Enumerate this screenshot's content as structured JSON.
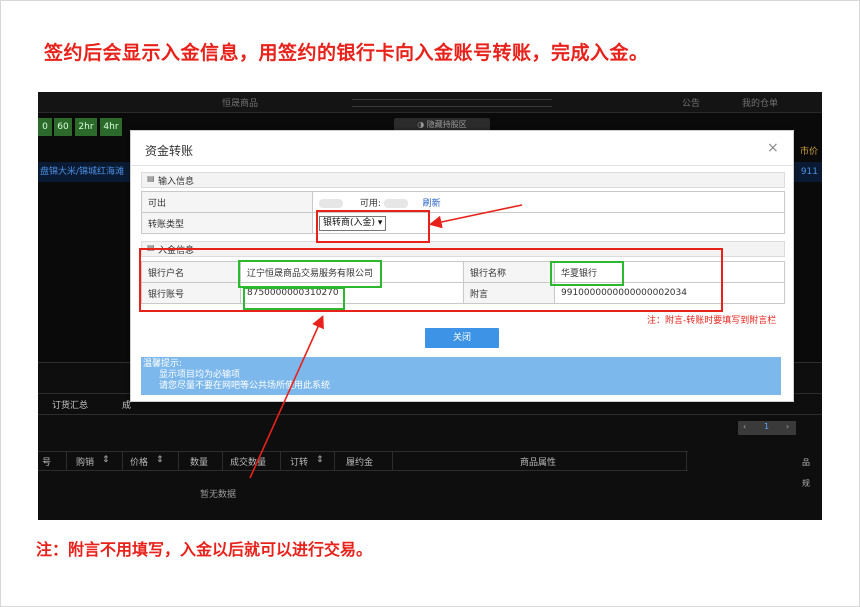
{
  "heading": "签约后会显示入金信息，用签约的银行卡向入金账号转账，完成入金。",
  "footnote": "注：附言不用填写，入金以后就可以进行交易。",
  "background_app": {
    "top_title": "恒晟商品",
    "top_links": [
      "公告",
      "我的仓单"
    ],
    "time_buttons": [
      "0",
      "60",
      "2hr",
      "4hr"
    ],
    "hide_chart_label": "隐藏持股区",
    "market_row_left": "盘锦大米/锦城红海滩",
    "market_row_right": "911",
    "price_header": "市价",
    "tabs": [
      "订货汇总",
      "成"
    ],
    "pager_page": "1",
    "grid_columns": [
      "号",
      "购销",
      "价格",
      "数量",
      "成交数量",
      "订转",
      "履约金",
      "商品属性"
    ],
    "no_data": "暂无数据",
    "right_labels": [
      "品",
      "规"
    ]
  },
  "modal": {
    "title": "资金转账",
    "section_input_title": "输入信息",
    "withdrawable_label": "可出",
    "available_label": "可用:",
    "refresh_link": "刷新",
    "transfer_type_label": "转账类型",
    "transfer_type_value": "银转商(入金)",
    "section_deposit_title": "入金信息",
    "account_name_label": "银行户名",
    "account_name_value": "辽宁恒晟商品交易服务有限公司",
    "bank_name_label": "银行名称",
    "bank_name_value": "华夏银行",
    "account_no_label": "银行账号",
    "account_no_value": "8750000000310270",
    "memo_label": "附言",
    "memo_value": "9910000000000000002034",
    "memo_note": "注：附言-转账时要填写到附言栏",
    "close_button": "关闭",
    "tip_title": "温馨提示:",
    "tip_lines": [
      "显示项目均为必输项",
      "请您尽量不要在网吧等公共场所使用此系统"
    ]
  },
  "colors": {
    "annotation_red": "#e8221b",
    "annotation_green": "#2eb82e",
    "button_blue": "#3d94e6",
    "tip_blue": "#7db8ec"
  }
}
